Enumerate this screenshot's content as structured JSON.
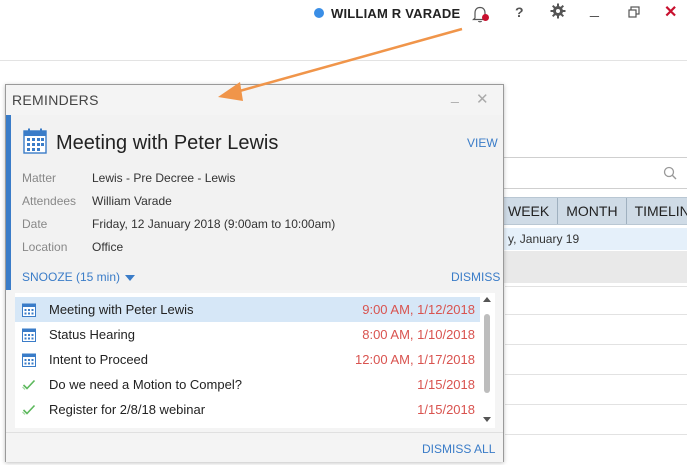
{
  "titlebar": {
    "user_name": "WILLIAM R VARADE",
    "status_color": "#3a8ee6",
    "icons": [
      "bell-icon",
      "help-icon",
      "gear-icon",
      "minimize-icon",
      "restore-icon",
      "close-icon"
    ],
    "help_glyph": "?",
    "minimize_glyph": "_",
    "close_glyph": "✕"
  },
  "background": {
    "view_tabs": [
      "WEEK",
      "MONTH",
      "TIMELINE"
    ],
    "date_label": "y, January 19"
  },
  "reminders": {
    "title": "REMINDERS",
    "minimize_glyph": "_",
    "close_glyph": "✕",
    "detail": {
      "title": "Meeting with Peter Lewis",
      "view_label": "VIEW",
      "fields": [
        {
          "label": "Matter",
          "value": "Lewis - Pre Decree - Lewis"
        },
        {
          "label": "Attendees",
          "value": "William Varade"
        },
        {
          "label": "Date",
          "value": "Friday, 12 January 2018 (9:00am to 10:00am)"
        },
        {
          "label": "Location",
          "value": "Office"
        }
      ],
      "snooze_label": "SNOOZE (15 min)",
      "dismiss_label": "DISMISS"
    },
    "items": [
      {
        "icon": "calendar-icon",
        "title": "Meeting with Peter Lewis",
        "time": "9:00 AM, 1/12/2018",
        "selected": true
      },
      {
        "icon": "calendar-icon",
        "title": "Status Hearing",
        "time": "8:00 AM, 1/10/2018",
        "selected": false
      },
      {
        "icon": "calendar-icon",
        "title": "Intent to Proceed",
        "time": "12:00 AM, 1/17/2018",
        "selected": false
      },
      {
        "icon": "task-check-icon",
        "title": "Do we need a Motion to Compel?",
        "time": "1/15/2018",
        "selected": false
      },
      {
        "icon": "task-check-icon",
        "title": "Register for 2/8/18 webinar",
        "time": "1/15/2018",
        "selected": false
      }
    ],
    "dismiss_all_label": "DISMISS ALL"
  },
  "colors": {
    "accent": "#3a7cc8",
    "time_red": "#d9534f",
    "selected_row": "#d6e7f7",
    "annotation_arrow": "#f0954a"
  }
}
